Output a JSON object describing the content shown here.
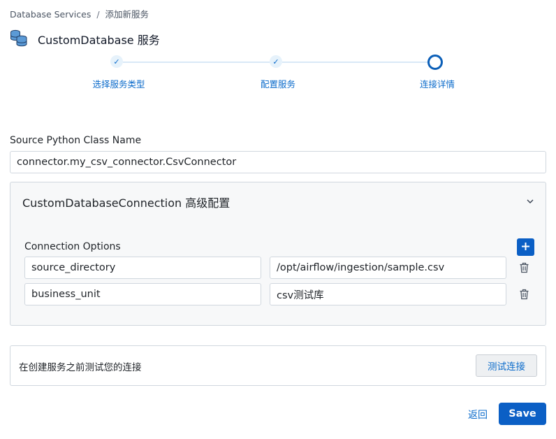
{
  "breadcrumb": {
    "root": "Database Services",
    "separator": "/",
    "current": "添加新服务"
  },
  "header": {
    "title": "CustomDatabase 服务",
    "icon": "database-stack-icon"
  },
  "stepper": {
    "steps": [
      {
        "label": "选择服务类型",
        "state": "completed"
      },
      {
        "label": "配置服务",
        "state": "completed"
      },
      {
        "label": "连接详情",
        "state": "active"
      }
    ],
    "check_glyph": "✓"
  },
  "form": {
    "source_class_label": "Source Python Class Name",
    "source_class_value": "connector.my_csv_connector.CsvConnector"
  },
  "advanced": {
    "title": "CustomDatabaseConnection 高级配置",
    "connection_options_label": "Connection Options",
    "options": [
      {
        "key": "source_directory",
        "value": "/opt/airflow/ingestion/sample.csv"
      },
      {
        "key": "business_unit",
        "value": "csv测试库"
      }
    ]
  },
  "test_connection": {
    "text": "在创建服务之前测试您的连接",
    "button_label": "测试连接"
  },
  "footer": {
    "back_label": "返回",
    "save_label": "Save"
  },
  "colors": {
    "accent": "#0b5fc5",
    "link": "#0b6bcb",
    "step_bg": "#e6f2fb",
    "panel_bg": "#f7f8f9"
  }
}
